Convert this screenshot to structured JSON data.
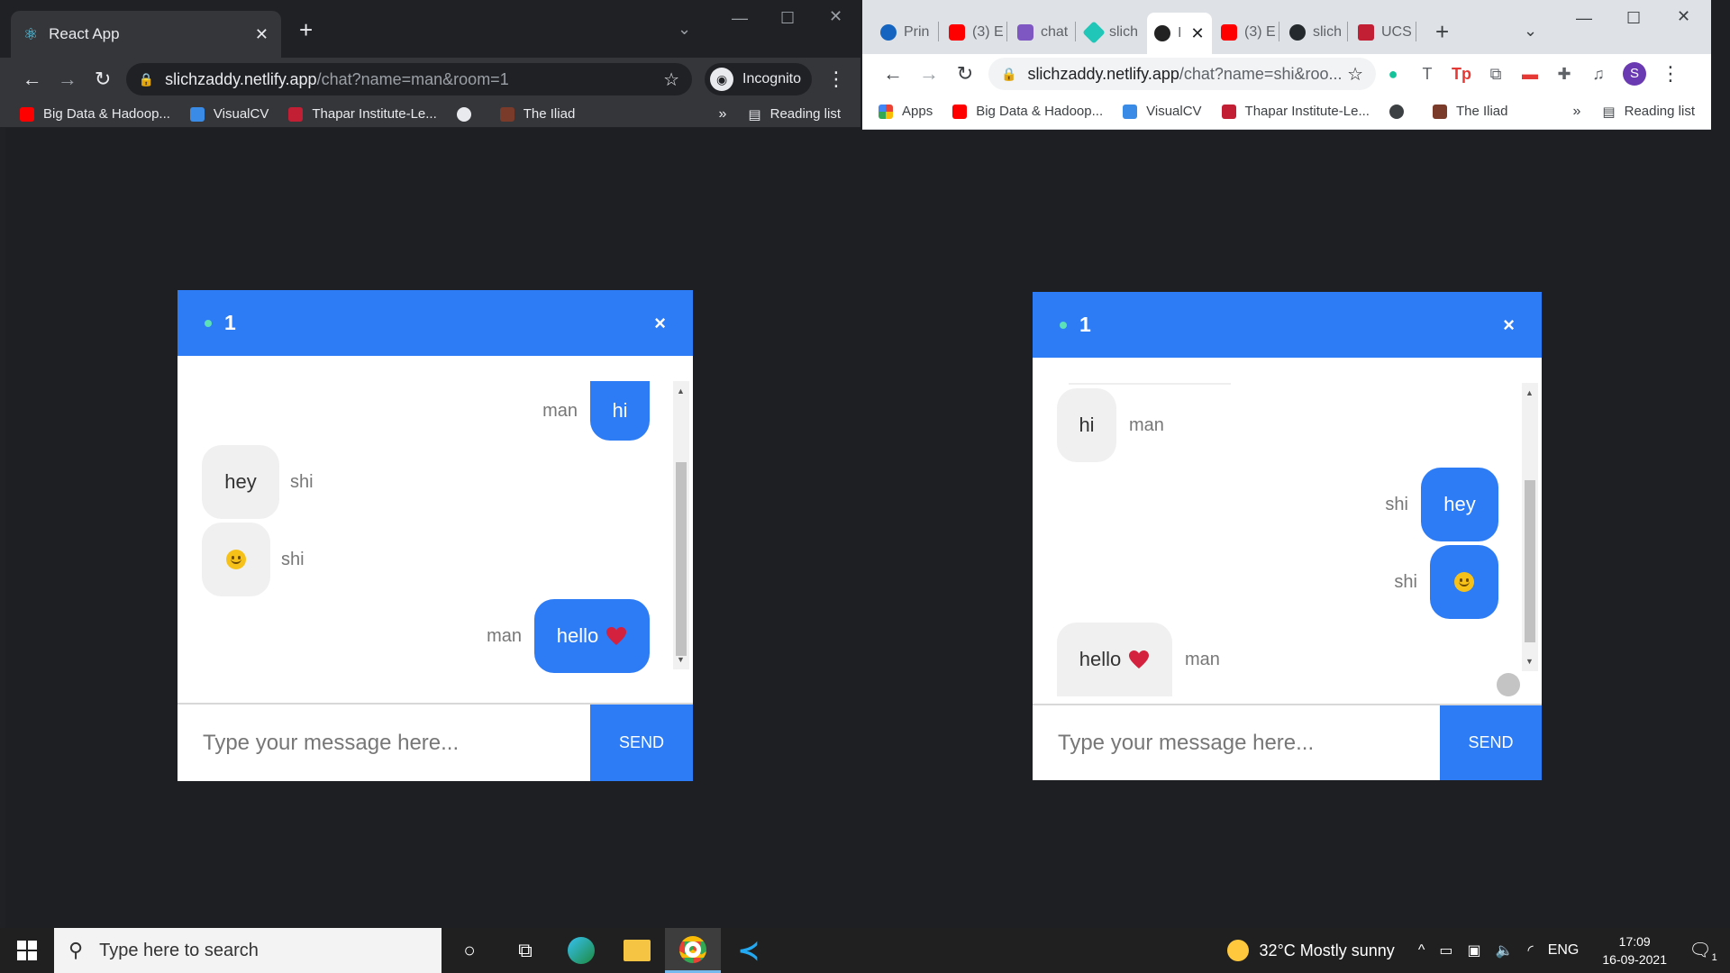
{
  "left_window": {
    "tab_title": "React App",
    "url_host": "slichzaddy.netlify.app",
    "url_path": "/chat?name=man&room=1",
    "incognito_label": "Incognito",
    "bookmarks": [
      "Big Data & Hadoop...",
      "VisualCV",
      "Thapar Institute-Le...",
      "",
      "The Iliad"
    ],
    "reading_list": "Reading list",
    "more": "»"
  },
  "right_window": {
    "tabs": [
      "Prin",
      "(3) E",
      "chat",
      "slich",
      "I",
      "(3) E",
      "slich",
      "UCS"
    ],
    "url_host": "slichzaddy.netlify.app",
    "url_path": "/chat?name=shi&roo...",
    "avatar_letter": "S",
    "bookmarks": [
      "Apps",
      "Big Data & Hadoop...",
      "VisualCV",
      "Thapar Institute-Le...",
      "",
      "The Iliad"
    ],
    "reading_list": "Reading list",
    "more": "»"
  },
  "chat_left": {
    "room": "1",
    "close": "×",
    "placeholder": "Type your message here...",
    "send_label": "SEND",
    "messages": [
      {
        "user": "man",
        "text": "hi",
        "mine": true
      },
      {
        "user": "shi",
        "text": "hey",
        "mine": false
      },
      {
        "user": "shi",
        "text": "",
        "emoji": "smile",
        "mine": false
      },
      {
        "user": "man",
        "text": "hello",
        "heart": true,
        "mine": true
      }
    ]
  },
  "chat_right": {
    "room": "1",
    "close": "×",
    "placeholder": "Type your message here...",
    "send_label": "SEND",
    "messages": [
      {
        "user": "man",
        "text": "hi",
        "mine": false
      },
      {
        "user": "shi",
        "text": "hey",
        "mine": true
      },
      {
        "user": "shi",
        "text": "",
        "emoji": "smile",
        "mine": true
      },
      {
        "user": "man",
        "text": "hello",
        "heart": true,
        "mine": false
      }
    ]
  },
  "taskbar": {
    "search_placeholder": "Type here to search",
    "weather": "32°C  Mostly sunny",
    "lang": "ENG",
    "time": "17:09",
    "date": "16-09-2021",
    "notif_count": "1"
  },
  "colors": {
    "accent": "#2d7cf6",
    "online_dot": "#5ce0b8",
    "heart": "#d4213d"
  }
}
